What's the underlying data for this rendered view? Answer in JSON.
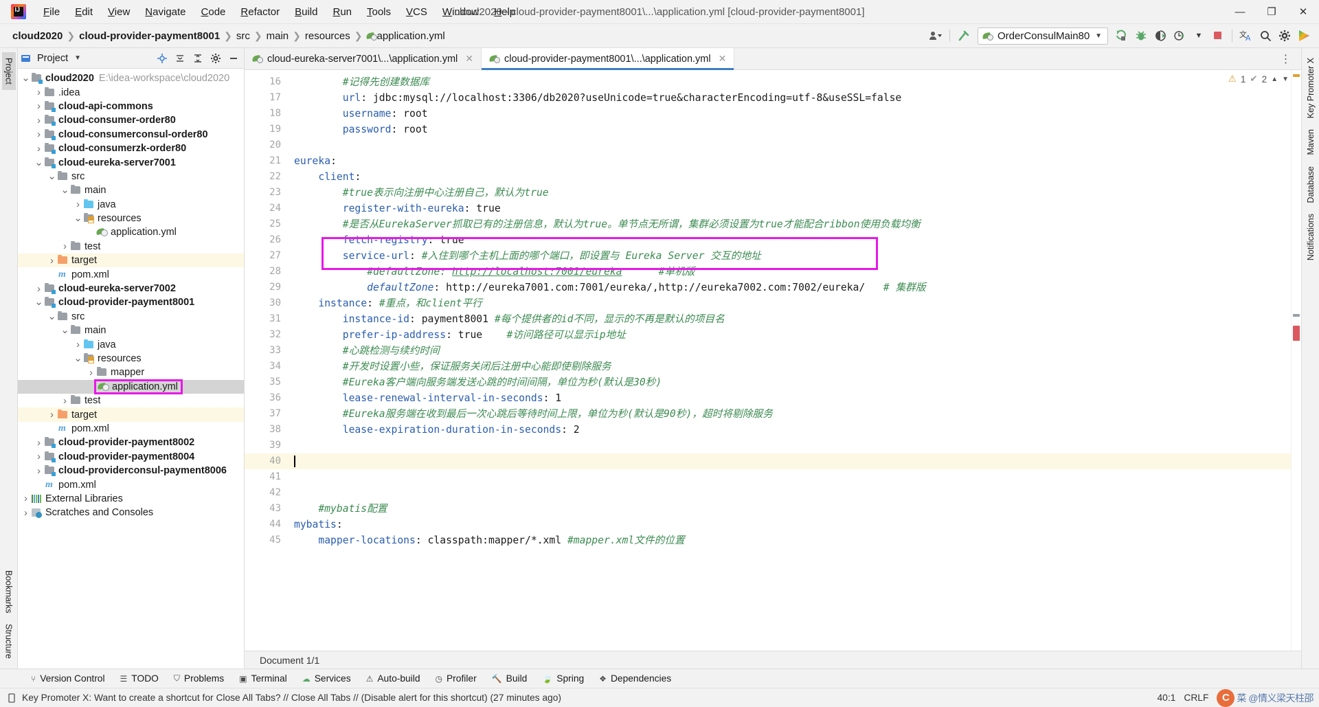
{
  "window": {
    "title": "cloud2020 - cloud-provider-payment8001\\...\\application.yml [cloud-provider-payment8001]",
    "minimize": "—",
    "maximize": "❐",
    "close": "✕"
  },
  "menu": [
    {
      "label": "File"
    },
    {
      "label": "Edit"
    },
    {
      "label": "View"
    },
    {
      "label": "Navigate"
    },
    {
      "label": "Code"
    },
    {
      "label": "Refactor"
    },
    {
      "label": "Build"
    },
    {
      "label": "Run"
    },
    {
      "label": "Tools"
    },
    {
      "label": "VCS"
    },
    {
      "label": "Window"
    },
    {
      "label": "Help"
    }
  ],
  "breadcrumbs": [
    {
      "label": "cloud2020",
      "bold": true
    },
    {
      "label": "cloud-provider-payment8001",
      "bold": true
    },
    {
      "label": "src",
      "bold": false
    },
    {
      "label": "main",
      "bold": false
    },
    {
      "label": "resources",
      "bold": false
    },
    {
      "label": "application.yml",
      "bold": false,
      "icon": "yml-icon"
    }
  ],
  "toolbar": {
    "run_config": "OrderConsulMain80",
    "icons": [
      "user-avatar-icon",
      "hammer-build-icon",
      "run-icon",
      "debug-icon",
      "coverage-icon",
      "profiler-icon",
      "stop-icon",
      "translate-icon",
      "search-everywhere-icon",
      "settings-gear-icon",
      "play-colored-icon"
    ]
  },
  "left_strip": [
    {
      "label": "Project",
      "selected": true
    },
    {
      "label": "Bookmarks",
      "selected": false
    },
    {
      "label": "Structure",
      "selected": false
    }
  ],
  "right_strip": [
    {
      "label": "Key Promoter X"
    },
    {
      "label": "Maven"
    },
    {
      "label": "Database"
    },
    {
      "label": "Notifications"
    }
  ],
  "project_panel": {
    "title": "Project",
    "header_icons": [
      "chevron-down-icon",
      "locate-icon",
      "collapse-all-icon",
      "expand-icon",
      "settings-gear-icon",
      "hide-icon"
    ],
    "tree": [
      {
        "depth": 0,
        "arrow": "down",
        "icon": "module-folder",
        "label": "cloud2020",
        "bold": true,
        "path": "E:\\idea-workspace\\cloud2020"
      },
      {
        "depth": 1,
        "arrow": "right",
        "icon": "plain-folder",
        "label": ".idea",
        "bold": false
      },
      {
        "depth": 1,
        "arrow": "right",
        "icon": "module-folder",
        "label": "cloud-api-commons",
        "bold": true
      },
      {
        "depth": 1,
        "arrow": "right",
        "icon": "module-folder",
        "label": "cloud-consumer-order80",
        "bold": true
      },
      {
        "depth": 1,
        "arrow": "right",
        "icon": "module-folder",
        "label": "cloud-consumerconsul-order80",
        "bold": true
      },
      {
        "depth": 1,
        "arrow": "right",
        "icon": "module-folder",
        "label": "cloud-consumerzk-order80",
        "bold": true
      },
      {
        "depth": 1,
        "arrow": "down",
        "icon": "module-folder",
        "label": "cloud-eureka-server7001",
        "bold": true
      },
      {
        "depth": 2,
        "arrow": "down",
        "icon": "plain-folder",
        "label": "src",
        "bold": false
      },
      {
        "depth": 3,
        "arrow": "down",
        "icon": "plain-folder",
        "label": "main",
        "bold": false
      },
      {
        "depth": 4,
        "arrow": "right",
        "icon": "java-folder",
        "label": "java",
        "bold": false
      },
      {
        "depth": 4,
        "arrow": "down",
        "icon": "resources-folder",
        "label": "resources",
        "bold": false
      },
      {
        "depth": 5,
        "arrow": "none",
        "icon": "yml-file",
        "label": "application.yml",
        "bold": false
      },
      {
        "depth": 3,
        "arrow": "right",
        "icon": "plain-folder",
        "label": "test",
        "bold": false
      },
      {
        "depth": 2,
        "arrow": "right",
        "icon": "target-folder",
        "label": "target",
        "bold": false,
        "highlight": "target"
      },
      {
        "depth": 2,
        "arrow": "none",
        "icon": "maven-file",
        "label": "pom.xml",
        "bold": false
      },
      {
        "depth": 1,
        "arrow": "right",
        "icon": "module-folder",
        "label": "cloud-eureka-server7002",
        "bold": true
      },
      {
        "depth": 1,
        "arrow": "down",
        "icon": "module-folder",
        "label": "cloud-provider-payment8001",
        "bold": true
      },
      {
        "depth": 2,
        "arrow": "down",
        "icon": "plain-folder",
        "label": "src",
        "bold": false
      },
      {
        "depth": 3,
        "arrow": "down",
        "icon": "plain-folder",
        "label": "main",
        "bold": false
      },
      {
        "depth": 4,
        "arrow": "right",
        "icon": "java-folder",
        "label": "java",
        "bold": false
      },
      {
        "depth": 4,
        "arrow": "down",
        "icon": "resources-folder",
        "label": "resources",
        "bold": false
      },
      {
        "depth": 5,
        "arrow": "right",
        "icon": "plain-folder",
        "label": "mapper",
        "bold": false
      },
      {
        "depth": 5,
        "arrow": "none",
        "icon": "yml-file",
        "label": "application.yml",
        "bold": false,
        "selected": true,
        "boxed": true
      },
      {
        "depth": 3,
        "arrow": "right",
        "icon": "plain-folder",
        "label": "test",
        "bold": false
      },
      {
        "depth": 2,
        "arrow": "right",
        "icon": "target-folder",
        "label": "target",
        "bold": false,
        "highlight": "target"
      },
      {
        "depth": 2,
        "arrow": "none",
        "icon": "maven-file",
        "label": "pom.xml",
        "bold": false
      },
      {
        "depth": 1,
        "arrow": "right",
        "icon": "module-folder",
        "label": "cloud-provider-payment8002",
        "bold": true
      },
      {
        "depth": 1,
        "arrow": "right",
        "icon": "module-folder",
        "label": "cloud-provider-payment8004",
        "bold": true
      },
      {
        "depth": 1,
        "arrow": "right",
        "icon": "module-folder",
        "label": "cloud-providerconsul-payment8006",
        "bold": true
      },
      {
        "depth": 1,
        "arrow": "none",
        "icon": "maven-file",
        "label": "pom.xml",
        "bold": false
      },
      {
        "depth": 0,
        "arrow": "right",
        "icon": "libraries",
        "label": "External Libraries",
        "bold": false
      },
      {
        "depth": 0,
        "arrow": "right",
        "icon": "scratches",
        "label": "Scratches and Consoles",
        "bold": false
      }
    ]
  },
  "editor_tabs": [
    {
      "label": "cloud-eureka-server7001\\...\\application.yml",
      "active": false
    },
    {
      "label": "cloud-provider-payment8001\\...\\application.yml",
      "active": true
    }
  ],
  "inspections": {
    "warnings": "1",
    "weak_warnings": "2"
  },
  "editor": {
    "first_line": 16,
    "caret_line": 40,
    "lines": [
      {
        "n": 16,
        "indent": 4,
        "segs": [
          {
            "t": "#记得先创建数据库",
            "c": "cm"
          }
        ]
      },
      {
        "n": 17,
        "indent": 4,
        "segs": [
          {
            "t": "url",
            "c": "k"
          },
          {
            "t": ": jdbc:mysql://localhost:3306/db2020?useUnicode=true&characterEncoding=utf-8&useSSL=false",
            "c": "v"
          }
        ]
      },
      {
        "n": 18,
        "indent": 4,
        "segs": [
          {
            "t": "username",
            "c": "k"
          },
          {
            "t": ": root",
            "c": "v"
          }
        ]
      },
      {
        "n": 19,
        "indent": 4,
        "fold": "end",
        "segs": [
          {
            "t": "password",
            "c": "k"
          },
          {
            "t": ": root",
            "c": "v"
          }
        ]
      },
      {
        "n": 20,
        "indent": 0,
        "segs": []
      },
      {
        "n": 21,
        "indent": 0,
        "fold": "start",
        "segs": [
          {
            "t": "eureka",
            "c": "k"
          },
          {
            "t": ":",
            "c": "v"
          }
        ]
      },
      {
        "n": 22,
        "indent": 2,
        "fold": "start",
        "segs": [
          {
            "t": "client",
            "c": "k"
          },
          {
            "t": ":",
            "c": "v"
          }
        ]
      },
      {
        "n": 23,
        "indent": 4,
        "segs": [
          {
            "t": "#true表示向注册中心注册自己，默认为true",
            "c": "cm"
          }
        ]
      },
      {
        "n": 24,
        "indent": 4,
        "segs": [
          {
            "t": "register-with-eureka",
            "c": "k"
          },
          {
            "t": ": true",
            "c": "v"
          }
        ]
      },
      {
        "n": 25,
        "indent": 4,
        "segs": [
          {
            "t": "#是否从EurekaServer抓取已有的注册信息，默认为true。单节点无所谓，集群必须设置为true才能配合ribbon使用负载均衡",
            "c": "cm"
          }
        ]
      },
      {
        "n": 26,
        "indent": 4,
        "segs": [
          {
            "t": "fetch-registry",
            "c": "k"
          },
          {
            "t": ": true",
            "c": "v"
          }
        ]
      },
      {
        "n": 27,
        "indent": 4,
        "fold": "start",
        "segs": [
          {
            "t": "service-url",
            "c": "k"
          },
          {
            "t": ": ",
            "c": "v"
          },
          {
            "t": "#入住到哪个主机上面的哪个端口，即设置与 Eureka Server 交互的地址",
            "c": "cm"
          }
        ]
      },
      {
        "n": 28,
        "indent": 6,
        "segs": [
          {
            "t": "#defaultZone: ",
            "c": "cm"
          },
          {
            "t": "http://localhost:7001/eureka",
            "c": "cmu"
          },
          {
            "t": "      #单机版",
            "c": "cm"
          }
        ]
      },
      {
        "n": 29,
        "indent": 6,
        "fold": "end",
        "segs": [
          {
            "t": "defaultZone",
            "c": "ki"
          },
          {
            "t": ": http://eureka7001.com:7001/eureka/,http://eureka7002.com:7002/eureka/",
            "c": "v"
          },
          {
            "t": "   # 集群版",
            "c": "cm"
          }
        ]
      },
      {
        "n": 30,
        "indent": 2,
        "fold": "start",
        "segs": [
          {
            "t": "instance",
            "c": "k"
          },
          {
            "t": ": ",
            "c": "v"
          },
          {
            "t": "#重点，和client平行",
            "c": "cm"
          }
        ]
      },
      {
        "n": 31,
        "indent": 4,
        "segs": [
          {
            "t": "instance-id",
            "c": "k"
          },
          {
            "t": ": payment8001 ",
            "c": "v"
          },
          {
            "t": "#每个提供者的id不同，显示的不再是默认的项目名",
            "c": "cm"
          }
        ]
      },
      {
        "n": 32,
        "indent": 4,
        "segs": [
          {
            "t": "prefer-ip-address",
            "c": "k"
          },
          {
            "t": ": true    ",
            "c": "v"
          },
          {
            "t": "#访问路径可以显示ip地址",
            "c": "cm"
          }
        ]
      },
      {
        "n": 33,
        "indent": 4,
        "segs": [
          {
            "t": "#心跳检测与续约时间",
            "c": "cm"
          }
        ]
      },
      {
        "n": 34,
        "indent": 4,
        "segs": [
          {
            "t": "#开发时设置小些，保证服务关闭后注册中心能即使剔除服务",
            "c": "cm"
          }
        ]
      },
      {
        "n": 35,
        "indent": 4,
        "segs": [
          {
            "t": "#Eureka客户端向服务端发送心跳的时间间隔，单位为秒(默认是30秒)",
            "c": "cm"
          }
        ]
      },
      {
        "n": 36,
        "indent": 4,
        "segs": [
          {
            "t": "lease-renewal-interval-in-seconds",
            "c": "k"
          },
          {
            "t": ": 1",
            "c": "v"
          }
        ]
      },
      {
        "n": 37,
        "indent": 4,
        "segs": [
          {
            "t": "#Eureka服务端在收到最后一次心跳后等待时间上限，单位为秒(默认是90秒)，超时将剔除服务",
            "c": "cm"
          }
        ]
      },
      {
        "n": 38,
        "indent": 4,
        "fold": "end",
        "segs": [
          {
            "t": "lease-expiration-duration-in-seconds",
            "c": "k"
          },
          {
            "t": ": 2",
            "c": "v"
          }
        ]
      },
      {
        "n": 39,
        "indent": 0,
        "segs": []
      },
      {
        "n": 40,
        "indent": 0,
        "caret": true,
        "segs": []
      },
      {
        "n": 41,
        "indent": 0,
        "segs": []
      },
      {
        "n": 42,
        "indent": 0,
        "segs": []
      },
      {
        "n": 43,
        "indent": 2,
        "segs": [
          {
            "t": "#mybatis配置",
            "c": "cm"
          }
        ]
      },
      {
        "n": 44,
        "indent": 0,
        "fold": "start",
        "segs": [
          {
            "t": "mybatis",
            "c": "k"
          },
          {
            "t": ":",
            "c": "v"
          }
        ]
      },
      {
        "n": 45,
        "indent": 2,
        "segs": [
          {
            "t": "mapper-locations",
            "c": "k"
          },
          {
            "t": ": classpath:mapper/*.xml ",
            "c": "v"
          },
          {
            "t": "#mapper.xml文件的位置",
            "c": "cm"
          }
        ]
      }
    ],
    "document_status": "Document 1/1"
  },
  "tool_windows": [
    {
      "label": "Version Control",
      "icon": "branch-icon"
    },
    {
      "label": "TODO",
      "icon": "todo-icon"
    },
    {
      "label": "Problems",
      "icon": "problems-icon"
    },
    {
      "label": "Terminal",
      "icon": "terminal-icon"
    },
    {
      "label": "Services",
      "icon": "services-icon"
    },
    {
      "label": "Auto-build",
      "icon": "autobuild-icon"
    },
    {
      "label": "Profiler",
      "icon": "profiler-icon"
    },
    {
      "label": "Build",
      "icon": "build-icon"
    },
    {
      "label": "Spring",
      "icon": "spring-icon"
    },
    {
      "label": "Dependencies",
      "icon": "dependencies-icon"
    }
  ],
  "statusbar": {
    "message": "Key Promoter X: Want to create a shortcut for Close All Tabs? // Close All Tabs // (Disable alert for this shortcut) (27 minutes ago)",
    "caret_position": "40:1",
    "line_separator": "CRLF",
    "watermark_badge": "C",
    "watermark_text": "菜 @情义梁天柱邵"
  }
}
